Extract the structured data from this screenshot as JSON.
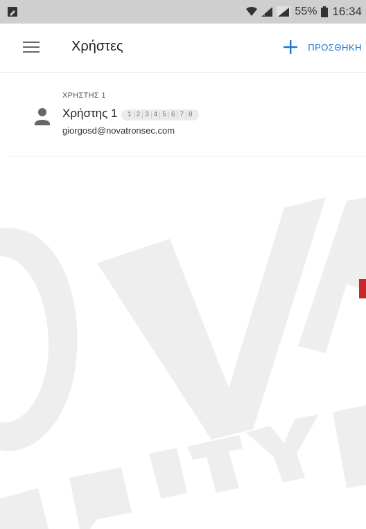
{
  "status_bar": {
    "battery_percent": "55%",
    "time": "16:34"
  },
  "app_bar": {
    "title": "Χρήστες",
    "add_label": "ΠΡΟΣΘΗΚΗ"
  },
  "users": [
    {
      "overline": "ΧΡΗΣΤΗΣ 1",
      "name": "Χρήστης 1",
      "slots": [
        "1",
        "2",
        "3",
        "4",
        "5",
        "6",
        "7",
        "8"
      ],
      "email": "giorgosd@novatronsec.com"
    }
  ],
  "colors": {
    "accent": "#1976d2",
    "status_bar_bg": "#cfcfcf",
    "watermark": "#ececec"
  },
  "icons": {
    "menu": "hamburger-menu-icon",
    "add": "plus-icon",
    "user": "person-icon"
  }
}
